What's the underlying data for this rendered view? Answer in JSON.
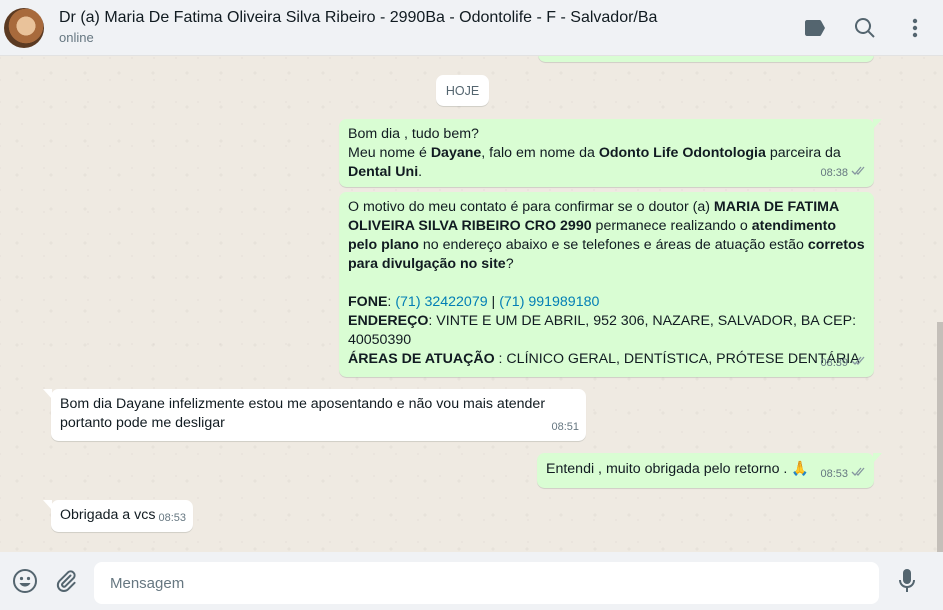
{
  "header": {
    "contact_name": "Dr (a) Maria De Fatima Oliveira Silva Ribeiro - 2990Ba - Odontolife - F - Salvador/Ba",
    "status": "online",
    "icons": [
      "label-icon",
      "search-icon",
      "menu-icon"
    ]
  },
  "chat": {
    "date_divider": "HOJE",
    "messages": [
      {
        "direction": "out",
        "parts": {
          "l1": "Bom dia , tudo bem?",
          "l2a": "Meu nome é ",
          "l2b": "Dayane",
          "l2c": ", falo em nome da ",
          "l2d": "Odonto Life Odontologia",
          "l2e": " parceira da",
          "l3a": "Dental Uni",
          "l3b": "."
        },
        "time": "08:38"
      },
      {
        "direction": "out",
        "parts": {
          "a1": "O motivo do meu contato é para confirmar se o doutor (a) ",
          "a2": "MARIA DE FATIMA OLIVEIRA SILVA RIBEIRO  CRO 2990",
          "a3": " permanece realizando o ",
          "a4": "atendimento pelo plano",
          "a5": " no endereço abaixo e se telefones e áreas de atuação estão ",
          "a6": "corretos para divulgação no site",
          "a7": "?",
          "fone_label": "FONE",
          "fone_sep": ": ",
          "phone1": "(71) 32422079",
          "phone_sep": " | ",
          "phone2": "(71) 991989180",
          "end_label": "ENDEREÇO",
          "end_value": ": VINTE E UM DE ABRIL, 952 306, NAZARE, SALVADOR, BA CEP: 40050390",
          "areas_label": "ÁREAS DE ATUAÇÃO",
          "areas_value": " : CLÍNICO GERAL, DENTÍSTICA, PRÓTESE DENTÁRIA"
        },
        "time": "08:39"
      },
      {
        "direction": "in",
        "text": "Bom dia Dayane infelizmente estou me aposentando e não vou mais atender portanto pode me desligar",
        "time": "08:51"
      },
      {
        "direction": "out",
        "text": "Entendi , muito obrigada pelo retorno . 🙏",
        "time": "08:53"
      },
      {
        "direction": "in",
        "text": "Obrigada a vcs",
        "time": "08:53"
      }
    ]
  },
  "footer": {
    "placeholder": "Mensagem",
    "icons": [
      "emoji-icon",
      "attach-icon",
      "microphone-icon"
    ]
  },
  "colors": {
    "outgoing_bubble": "#d9fdd3",
    "incoming_bubble": "#ffffff",
    "chat_background": "#efeae2",
    "link": "#027eb5",
    "read_ticks": "#8696a0"
  }
}
